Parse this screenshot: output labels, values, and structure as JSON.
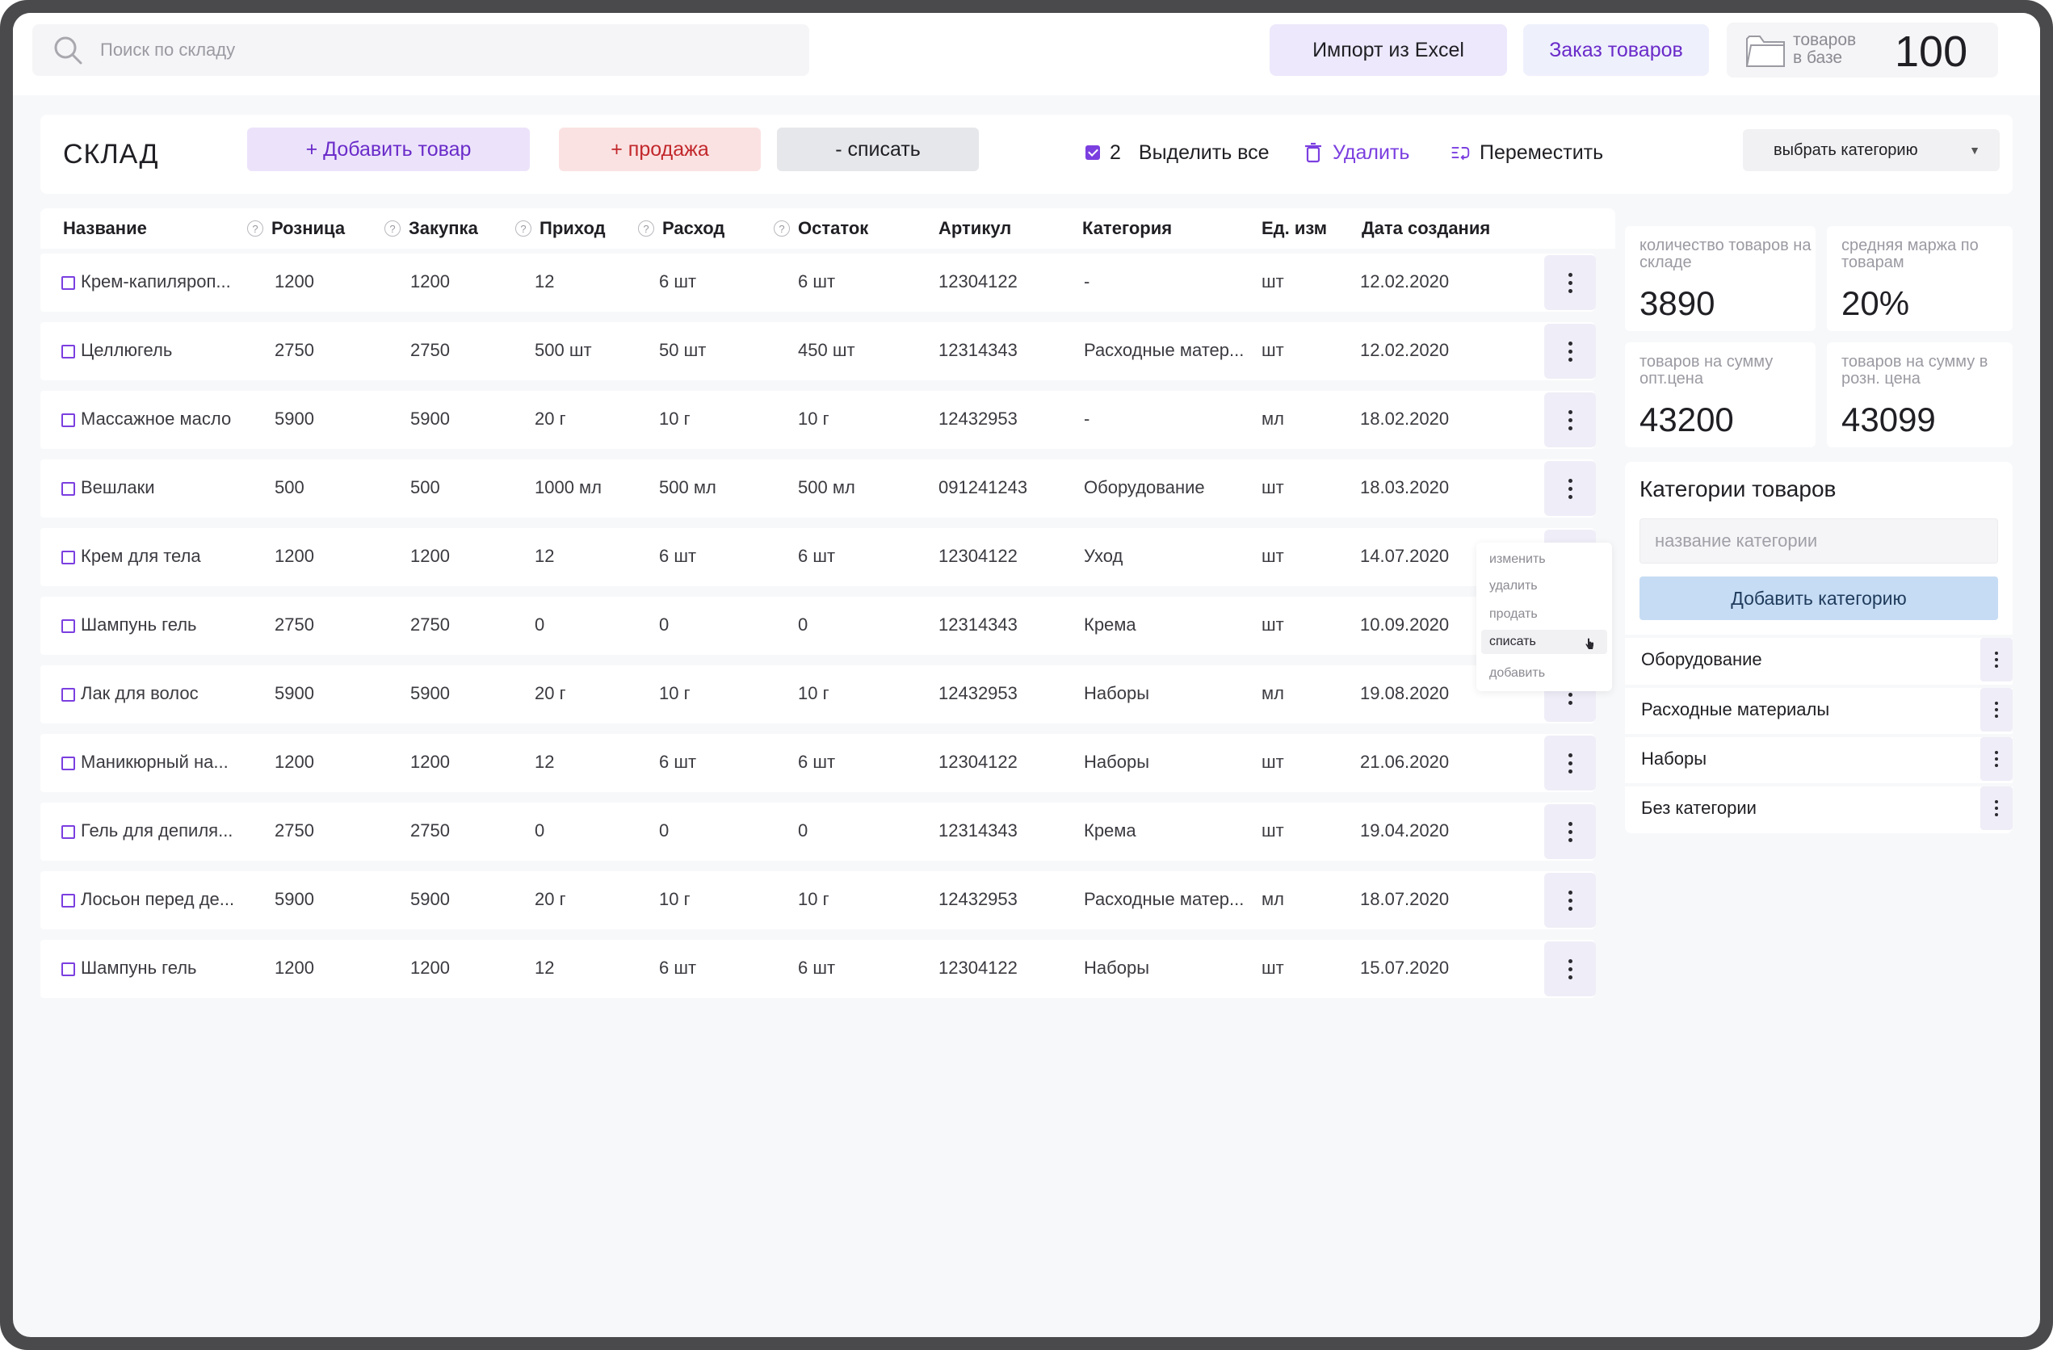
{
  "header": {
    "search_placeholder": "Поиск по складу",
    "import_label": "Импорт из Excel",
    "order_label": "Заказ товаров",
    "stock_label_1": "товаров",
    "stock_label_2": "в базе",
    "stock_count": "100"
  },
  "toolbar": {
    "title": "СКЛАД",
    "add_label": "+ Добавить товар",
    "sale_label": "+ продажа",
    "writeoff_label": "- списать",
    "selected_count": "2",
    "select_all_label": "Выделить все",
    "delete_label": "Удалить",
    "move_label": "Переместить",
    "category_select": "выбрать категорию"
  },
  "table": {
    "headers": [
      "Название",
      "Розница",
      "Закупка",
      "Приход",
      "Расход",
      "Остаток",
      "Артикул",
      "Категория",
      "Ед. изм",
      "Дата создания"
    ],
    "rows": [
      [
        "Крем-капиляроп...",
        "1200",
        "1200",
        "12",
        "6 шт",
        "6 шт",
        "12304122",
        "-",
        "шт",
        "12.02.2020"
      ],
      [
        "Целлюгель",
        "2750",
        "2750",
        "500 шт",
        "50 шт",
        "450 шт",
        "12314343",
        "Расходные матер...",
        "шт",
        "12.02.2020"
      ],
      [
        "Массажное масло",
        "5900",
        "5900",
        "20 г",
        "10 г",
        "10 г",
        "12432953",
        "-",
        "мл",
        "18.02.2020"
      ],
      [
        "Вешлаки",
        "500",
        "500",
        "1000 мл",
        "500 мл",
        "500 мл",
        "091241243",
        "Оборудование",
        "шт",
        "18.03.2020"
      ],
      [
        "Крем для тела",
        "1200",
        "1200",
        "12",
        "6 шт",
        "6 шт",
        "12304122",
        "Уход",
        "шт",
        "14.07.2020"
      ],
      [
        "Шампунь гель",
        "2750",
        "2750",
        "0",
        "0",
        "0",
        "12314343",
        "Крема",
        "шт",
        "10.09.2020"
      ],
      [
        "Лак для волос",
        "5900",
        "5900",
        "20 г",
        "10 г",
        "10 г",
        "12432953",
        "Наборы",
        "мл",
        "19.08.2020"
      ],
      [
        "Маникюрный на...",
        "1200",
        "1200",
        "12",
        "6 шт",
        "6 шт",
        "12304122",
        "Наборы",
        "шт",
        "21.06.2020"
      ],
      [
        "Гель для депиля...",
        "2750",
        "2750",
        "0",
        "0",
        "0",
        "12314343",
        "Крема",
        "шт",
        "19.04.2020"
      ],
      [
        "Лосьон перед де...",
        "5900",
        "5900",
        "20 г",
        "10 г",
        "10 г",
        "12432953",
        "Расходные матер...",
        "мл",
        "18.07.2020"
      ],
      [
        "Шампунь гель",
        "1200",
        "1200",
        "12",
        "6 шт",
        "6 шт",
        "12304122",
        "Наборы",
        "шт",
        "15.07.2020"
      ]
    ]
  },
  "row_menu": {
    "items": [
      "изменить",
      "удалить",
      "продать",
      "списать",
      "добавить"
    ],
    "highlighted": "списать"
  },
  "stats": [
    {
      "label": "количество товаров на складе",
      "value": "3890"
    },
    {
      "label": "средняя маржа по товарам",
      "value": "20%"
    },
    {
      "label": "товаров на сумму опт.цена",
      "value": "43200"
    },
    {
      "label": "товаров на сумму в розн. цена",
      "value": "43099"
    }
  ],
  "categories": {
    "title": "Категории товаров",
    "input_placeholder": "название категории",
    "add_label": "Добавить категорию",
    "items": [
      "Оборудование",
      "Расходные материалы",
      "Наборы",
      "Без категории"
    ]
  },
  "colors": {
    "accent": "#7b3fe0",
    "sale": "#c2282c",
    "add_bg": "#ece3fb",
    "sale_bg": "#fbe2e2",
    "category_btn_bg": "#c6dcf4"
  }
}
